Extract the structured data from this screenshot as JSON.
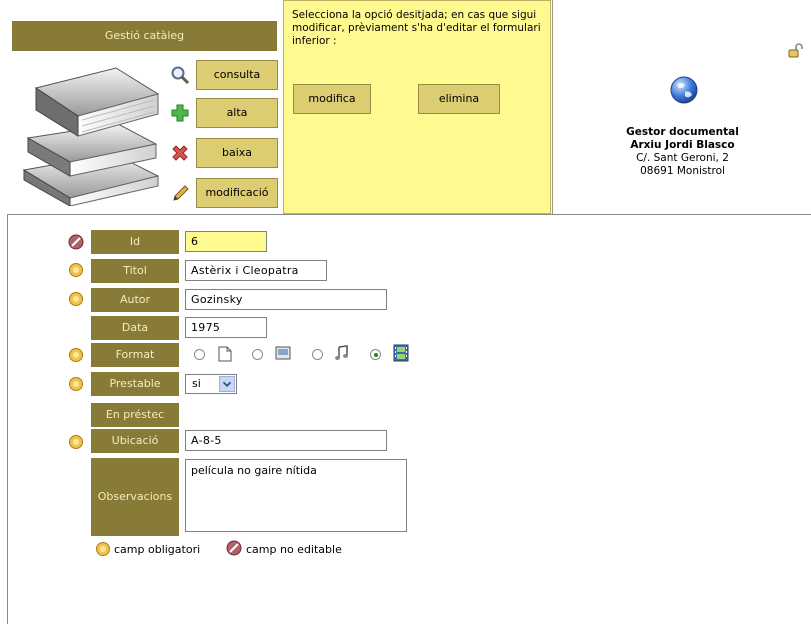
{
  "header": {
    "title": "Gestió catàleg",
    "ops": {
      "consulta": "consulta",
      "alta": "alta",
      "baixa": "baixa",
      "modificacio": "modificació"
    },
    "instruction": "Selecciona la opció desitjada; en cas que sigui modificar, prèviament s'ha d'editar el formulari inferior :",
    "actions": {
      "modifica": "modifica",
      "elimina": "elimina"
    },
    "info": {
      "line1": "Gestor documental",
      "line2": "Arxiu Jordi Blasco",
      "line3": "C/. Sant Geroni, 2",
      "line4": "08691 Monistrol"
    }
  },
  "form": {
    "id": {
      "label": "Id",
      "value": "6"
    },
    "titol": {
      "label": "Titol",
      "value": "Astèrix i Cleopatra"
    },
    "autor": {
      "label": "Autor",
      "value": "Gozinsky"
    },
    "data": {
      "label": "Data",
      "value": "1975"
    },
    "format": {
      "label": "Format",
      "options": [
        "document",
        "image",
        "music",
        "video"
      ],
      "selected": "video"
    },
    "prestable": {
      "label": "Prestable",
      "value": "si"
    },
    "en_prestec": {
      "label": "En préstec"
    },
    "ubicacio": {
      "label": "Ubicació",
      "value": "A-8-5"
    },
    "observacions": {
      "label": "Observacions",
      "value": "película no gaire nítida"
    }
  },
  "legend": {
    "required": "camp obligatori",
    "readonly": "camp no editable"
  },
  "colors": {
    "label_bg": "#887a37",
    "label_text": "#f4eebd",
    "button_bg": "#dccd72",
    "panel_yellow": "#fffa8f"
  }
}
